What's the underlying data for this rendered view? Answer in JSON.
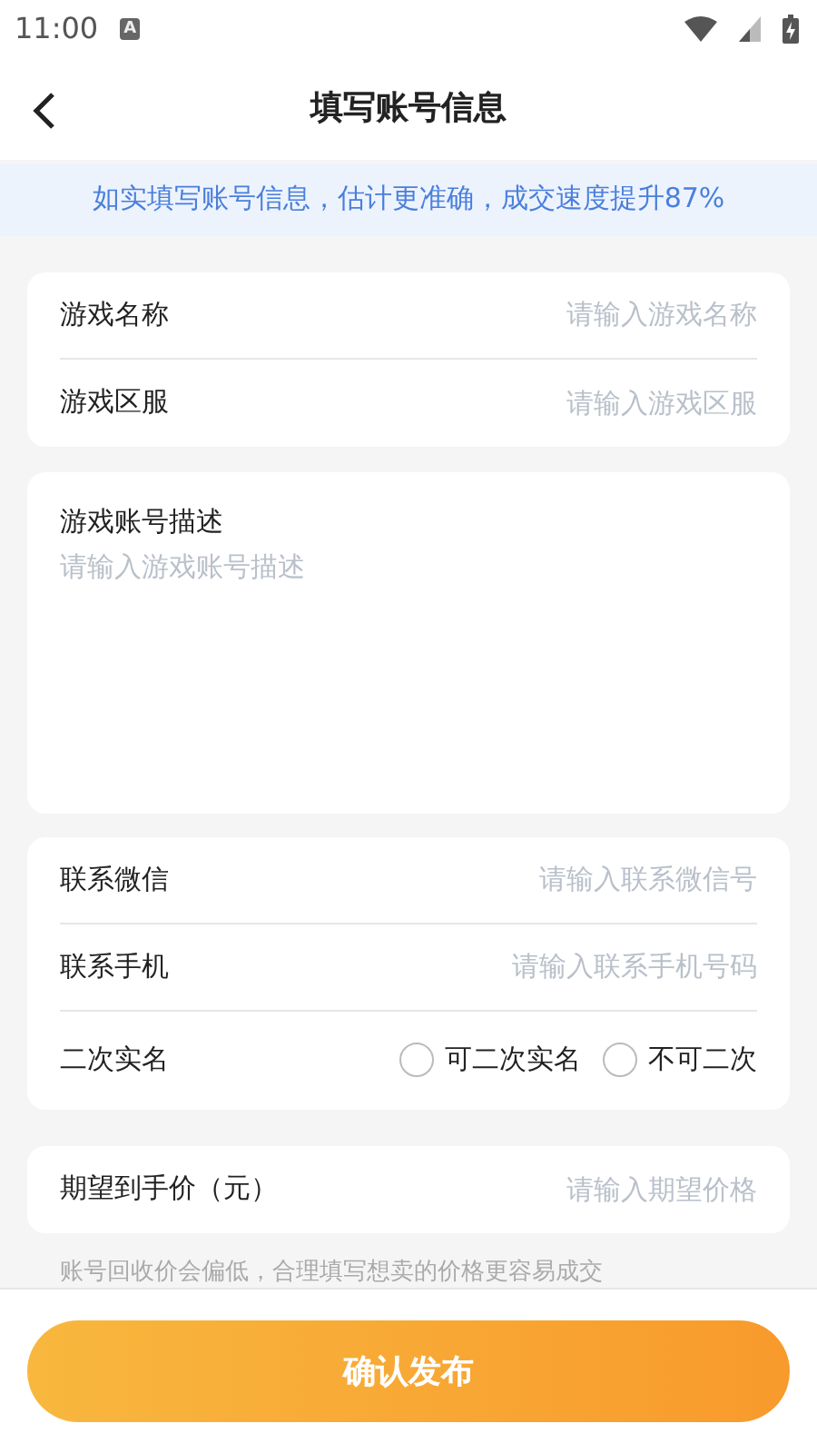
{
  "status_bar": {
    "time": "11:00",
    "badge": "A"
  },
  "header": {
    "title": "填写账号信息"
  },
  "banner": "如实填写账号信息，估计更准确，成交速度提升87%",
  "basic": [
    {
      "label": "游戏名称",
      "placeholder": "请输入游戏名称"
    },
    {
      "label": "游戏区服",
      "placeholder": "请输入游戏区服"
    }
  ],
  "description": {
    "label": "游戏账号描述",
    "placeholder": "请输入游戏账号描述"
  },
  "contact": [
    {
      "label": "联系微信",
      "placeholder": "请输入联系微信号"
    },
    {
      "label": "联系手机",
      "placeholder": "请输入联系手机号码"
    }
  ],
  "real_name": {
    "label": "二次实名",
    "options": [
      {
        "label": "可二次实名",
        "selected": false
      },
      {
        "label": "不可二次",
        "selected": false
      }
    ]
  },
  "price": {
    "label": "期望到手价（元）",
    "placeholder": "请输入期望价格"
  },
  "price_hint": "账号回收价会偏低，合理填写想卖的价格更容易成交",
  "submit": "确认发布"
}
